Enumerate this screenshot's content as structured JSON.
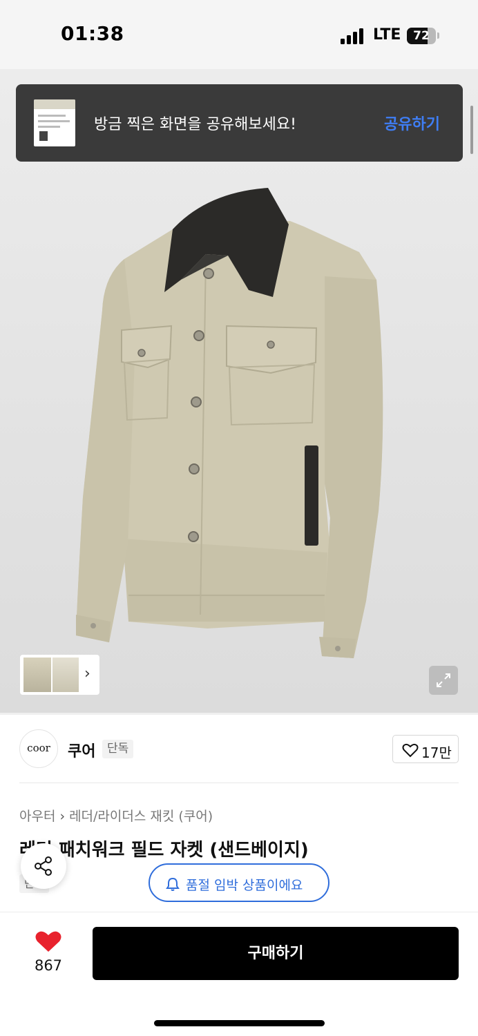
{
  "status_bar": {
    "time": "01:38",
    "network": "LTE",
    "battery": "72",
    "battery_level": 0.72,
    "signal_bars": 4
  },
  "share_toast": {
    "message": "방금 찍은 화면을 공유해보세요!",
    "action": "공유하기"
  },
  "brand": {
    "logo_text": "coor",
    "name": "쿠어",
    "badge": "단독",
    "like_count": "17만"
  },
  "breadcrumb": {
    "category": "아우터",
    "subcategory": "레더/라이더스 재킷 (쿠어)"
  },
  "product": {
    "title": "레더 패치워크 필드 자켓 (샌드베이지)",
    "tag": "단독",
    "soldout_notice": "품절 임박 상품이에요"
  },
  "bottom_bar": {
    "likes": "867",
    "buy_label": "구매하기"
  },
  "colors": {
    "accent_blue": "#2f6ddb",
    "toast_action": "#3f7ef5",
    "heart_red": "#e8222d",
    "jacket_sand": "#cfc9b1",
    "collar_leather": "#2b2a28"
  }
}
